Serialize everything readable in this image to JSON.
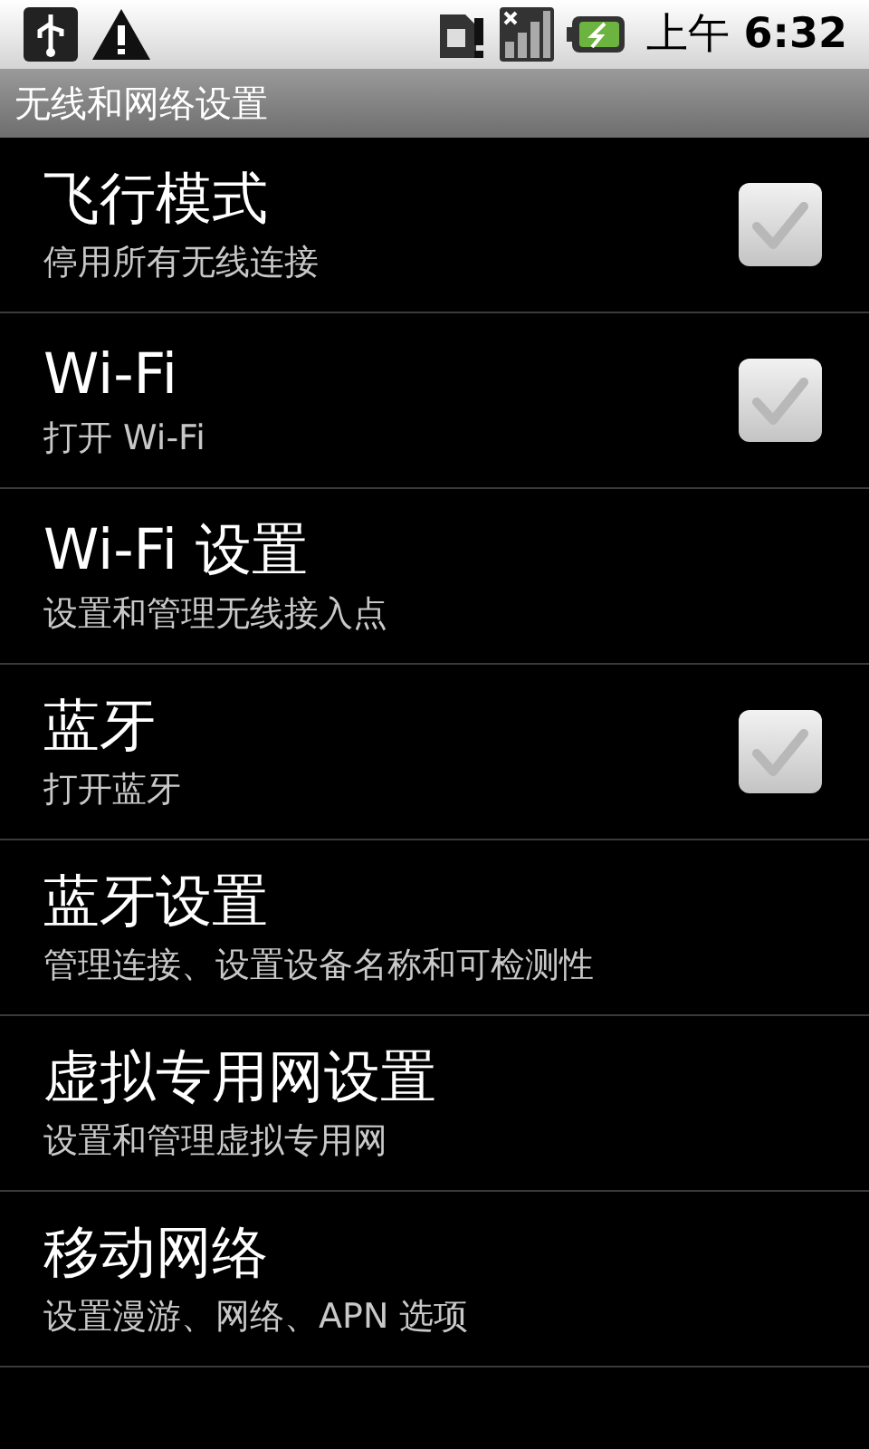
{
  "status_bar": {
    "time_prefix": "上午",
    "time": "6:32"
  },
  "title": "无线和网络设置",
  "items": [
    {
      "kind": "checkbox",
      "title": "飞行模式",
      "summary": "停用所有无线连接",
      "checked": false
    },
    {
      "kind": "checkbox",
      "title": "Wi-Fi",
      "summary": "打开 Wi-Fi",
      "checked": false
    },
    {
      "kind": "link",
      "title": "Wi-Fi 设置",
      "summary": "设置和管理无线接入点"
    },
    {
      "kind": "checkbox",
      "title": "蓝牙",
      "summary": "打开蓝牙",
      "checked": false
    },
    {
      "kind": "link",
      "title": "蓝牙设置",
      "summary": "管理连接、设置设备名称和可检测性"
    },
    {
      "kind": "link",
      "title": "虚拟专用网设置",
      "summary": "设置和管理虚拟专用网"
    },
    {
      "kind": "link",
      "title": "移动网络",
      "summary": "设置漫游、网络、APN 选项"
    }
  ]
}
